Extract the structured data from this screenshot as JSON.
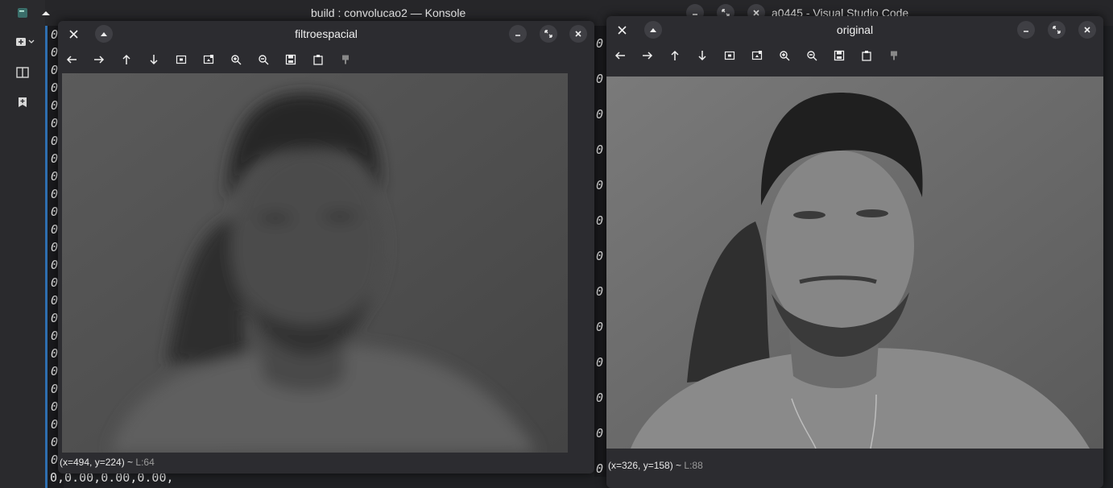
{
  "background": {
    "konsole_title": "build : convolucao2 — Konsole",
    "vscode_title": "a0445 - Visual Studio Code",
    "terminal_digit": "0",
    "terminal_bottom_line": "0,0.00,0.00,0.00,"
  },
  "windows": {
    "filtered": {
      "title": "filtroespacial",
      "status_coords": "(x=494, y=224) ~",
      "status_level": "L:64",
      "tone": "blurred"
    },
    "original": {
      "title": "original",
      "status_coords": "(x=326, y=158) ~",
      "status_level": "L:88",
      "tone": "sharp"
    }
  },
  "toolbar_icons": [
    "arrow-left-icon",
    "arrow-right-icon",
    "arrow-up-icon",
    "arrow-down-icon",
    "zoom-fit-icon",
    "zoom-original-icon",
    "zoom-in-icon",
    "zoom-out-icon",
    "save-icon",
    "copy-icon",
    "properties-icon"
  ],
  "colors": {
    "accent_bar": "#2f6fb0",
    "window_bg": "#2c2c30",
    "page_bg": "#202124"
  }
}
